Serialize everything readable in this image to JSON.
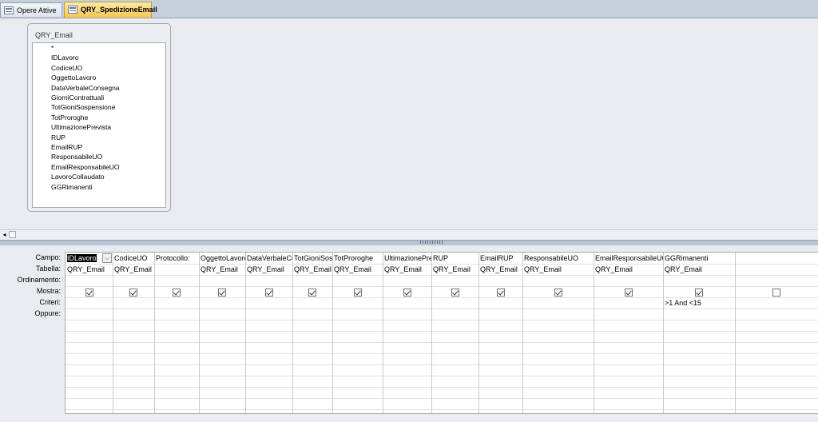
{
  "tabs": [
    {
      "label": "Opere Attive",
      "active": false
    },
    {
      "label": "QRY_SpedizioneEmail",
      "active": true
    }
  ],
  "field_list": {
    "title": "QRY_Email",
    "fields": [
      "*",
      "IDLavoro",
      "CodiceUO",
      "OggettoLavoro",
      "DataVerbaleConsegna",
      "GiorniContrattuali",
      "TotGioniSospensione",
      "TotProroghe",
      "UltimazionePrevista",
      "RUP",
      "EmailRUP",
      "ResponsabileUO",
      "EmailResponsabileUO",
      "LavoroCollaudato",
      "GGRimanenti"
    ]
  },
  "grid": {
    "row_labels": [
      "Campo:",
      "Tabella:",
      "Ordinamento:",
      "Mostra:",
      "Criteri:",
      "Oppure:"
    ],
    "columns": [
      {
        "campo": "IDLavoro",
        "tabella": "QRY_Email",
        "mostra": true,
        "criteri": "",
        "selected": true
      },
      {
        "campo": "CodiceUO",
        "tabella": "QRY_Email",
        "mostra": true,
        "criteri": ""
      },
      {
        "campo": "Protocollo:",
        "tabella": "",
        "mostra": true,
        "criteri": ""
      },
      {
        "campo": "OggettoLavoro",
        "tabella": "QRY_Email",
        "mostra": true,
        "criteri": ""
      },
      {
        "campo": "DataVerbaleConsegna",
        "tabella": "QRY_Email",
        "mostra": true,
        "criteri": ""
      },
      {
        "campo": "TotGioniSospensione",
        "tabella": "QRY_Email",
        "mostra": true,
        "criteri": ""
      },
      {
        "campo": "TotProroghe",
        "tabella": "QRY_Email",
        "mostra": true,
        "criteri": ""
      },
      {
        "campo": "UltimazionePrevista",
        "tabella": "QRY_Email",
        "mostra": true,
        "criteri": ""
      },
      {
        "campo": "RUP",
        "tabella": "QRY_Email",
        "mostra": true,
        "criteri": ""
      },
      {
        "campo": "EmailRUP",
        "tabella": "QRY_Email",
        "mostra": true,
        "criteri": ""
      },
      {
        "campo": "ResponsabileUO",
        "tabella": "QRY_Email",
        "mostra": true,
        "criteri": ""
      },
      {
        "campo": "EmailResponsabileUO",
        "tabella": "QRY_Email",
        "mostra": true,
        "criteri": ""
      },
      {
        "campo": "GGRimanenti",
        "tabella": "QRY_Email",
        "mostra": true,
        "criteri": ">1 And <15"
      },
      {
        "campo": "",
        "tabella": "",
        "mostra": false,
        "criteri": ""
      },
      {
        "campo": "",
        "tabella": "",
        "mostra": null,
        "criteri": ""
      }
    ]
  },
  "icons": {
    "tab_icon": "query-icon",
    "dropdown": "chevron-down-icon"
  },
  "colors": {
    "active_tab": "#f6c453",
    "selection": "#000000"
  }
}
